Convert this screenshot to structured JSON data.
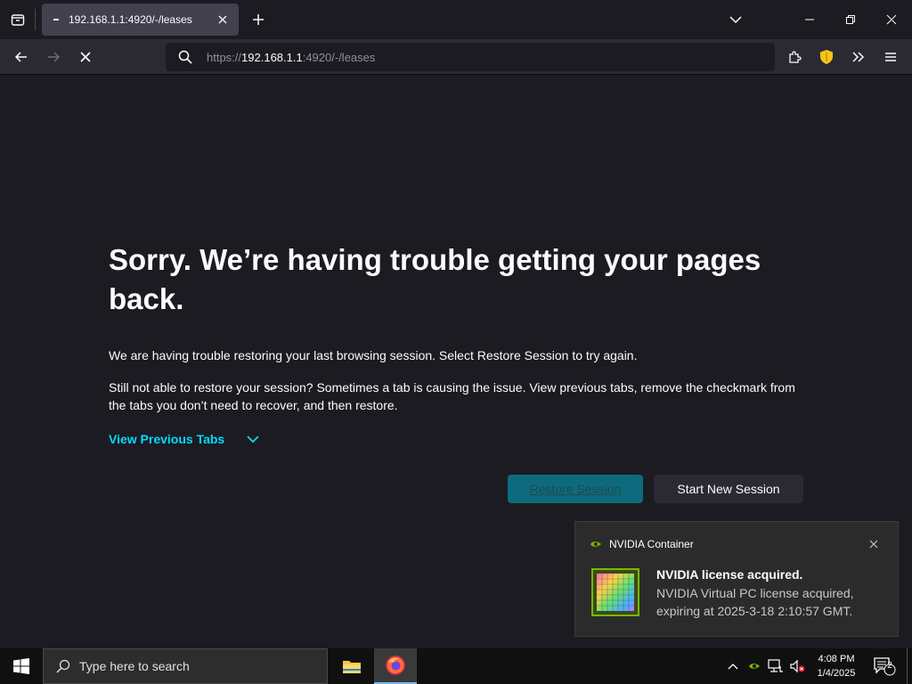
{
  "browser": {
    "tab": {
      "title": "192.168.1.1:4920/-/leases"
    },
    "url": {
      "scheme": "https://",
      "host": "192.168.1.1",
      "rest": ":4920/-/leases"
    }
  },
  "page": {
    "title": "Sorry. We’re having trouble getting your pages back.",
    "para1": "We are having trouble restoring your last browsing session. Select Restore Session to try again.",
    "para2": "Still not able to restore your session? Sometimes a tab is causing the issue. View previous tabs, remove the checkmark from the tabs you don’t need to recover, and then restore.",
    "view_previous_label": "View Previous Tabs",
    "restore_label": "Restore Session",
    "new_session_label": "Start New Session",
    "accent_color": "#00ddff"
  },
  "toast": {
    "app_name": "NVIDIA Container",
    "heading": "NVIDIA license acquired.",
    "body": "NVIDIA Virtual PC license acquired, expiring at 2025-3-18 2:10:57 GMT.",
    "brand_color": "#76b900"
  },
  "taskbar": {
    "search_placeholder": "Type here to search",
    "time": "4:08 PM",
    "date": "1/4/2025",
    "notification_count": "2"
  }
}
